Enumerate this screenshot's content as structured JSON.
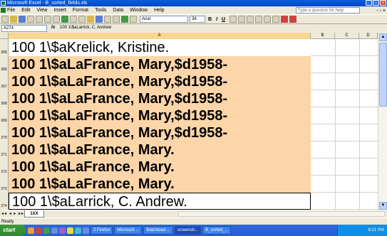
{
  "window": {
    "title": "Microsoft Excel - B_sorted_fields.xls"
  },
  "menu": {
    "items": [
      "File",
      "Edit",
      "View",
      "Insert",
      "Format",
      "Tools",
      "Data",
      "Window",
      "Help"
    ],
    "ask_placeholder": "Type a question for help"
  },
  "toolbar": {
    "font_name": "Arial",
    "font_size": "36",
    "bold": "B",
    "italic": "I",
    "underline": "U"
  },
  "formula": {
    "name_box": "A274",
    "fx": "fx",
    "content": "100  1\\$aLarrick, C. Andrew"
  },
  "columns": [
    "A",
    "B",
    "C",
    "D"
  ],
  "rows": [
    {
      "num": "265",
      "text": "100  1\\$aKrelick, Kristine.",
      "style": "plain"
    },
    {
      "num": "266",
      "text": "100  1\\$aLaFrance, Mary,$d1958-",
      "style": "hl"
    },
    {
      "num": "267",
      "text": "100  1\\$aLaFrance, Mary,$d1958-",
      "style": "hl"
    },
    {
      "num": "268",
      "text": "100  1\\$aLaFrance, Mary,$d1958-",
      "style": "hl"
    },
    {
      "num": "269",
      "text": "100  1\\$aLaFrance, Mary,$d1958-",
      "style": "hl"
    },
    {
      "num": "270",
      "text": "100  1\\$aLaFrance, Mary,$d1958-",
      "style": "hl"
    },
    {
      "num": "271",
      "text": "100  1\\$aLaFrance, Mary.",
      "style": "hl"
    },
    {
      "num": "272",
      "text": "100  1\\$aLaFrance, Mary.",
      "style": "hl"
    },
    {
      "num": "273",
      "text": "100  1\\$aLaFrance, Mary.",
      "style": "hl"
    },
    {
      "num": "274",
      "text": "100  1\\$aLarrick, C. Andrew.",
      "style": "boxed"
    }
  ],
  "sheet_tab": "1XX",
  "status": "Ready",
  "taskbar": {
    "start": "start",
    "tasks": [
      "2 Firefox",
      "Microsoft ...",
      "Batchload ...",
      "screensh...",
      "B_sorted_..."
    ],
    "clock": "8:21 PM"
  }
}
